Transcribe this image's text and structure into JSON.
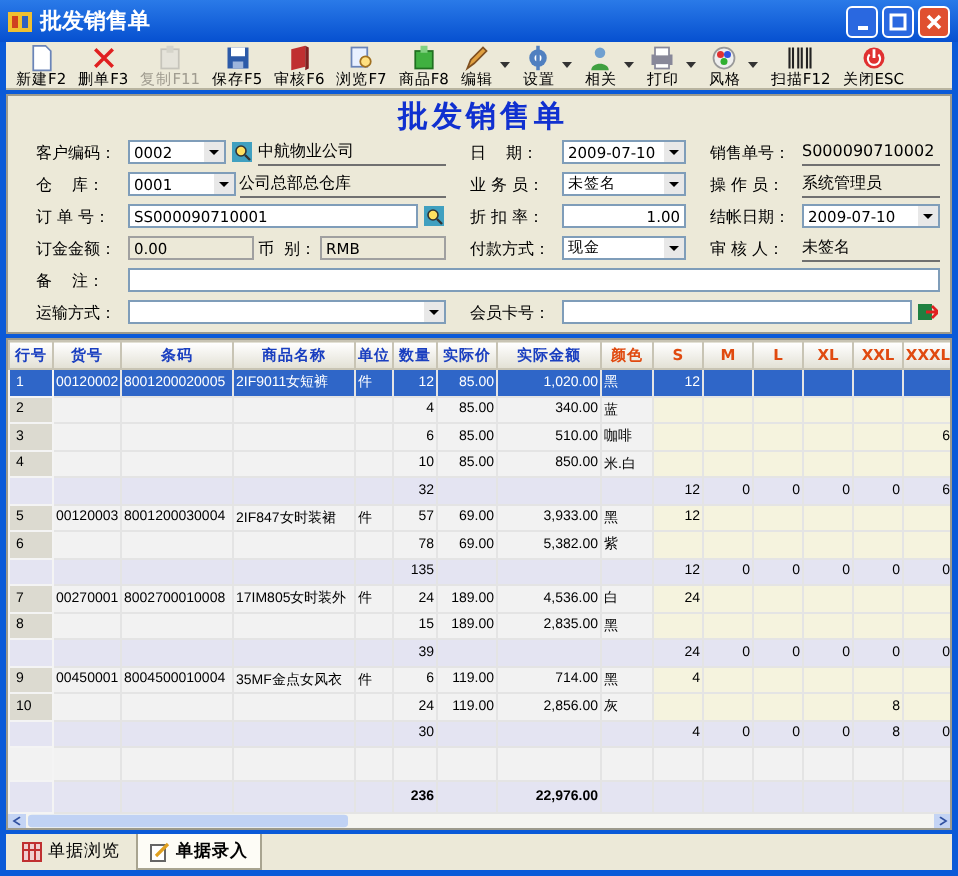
{
  "window": {
    "title": "批发销售单"
  },
  "toolbar": [
    {
      "label": "新建F2",
      "disabled": false,
      "dropdown": false
    },
    {
      "label": "删单F3",
      "disabled": false,
      "dropdown": false
    },
    {
      "label": "复制F11",
      "disabled": true,
      "dropdown": false
    },
    {
      "label": "保存F5",
      "disabled": false,
      "dropdown": false
    },
    {
      "label": "审核F6",
      "disabled": false,
      "dropdown": false
    },
    {
      "label": "浏览F7",
      "disabled": false,
      "dropdown": false
    },
    {
      "label": "商品F8",
      "disabled": false,
      "dropdown": false
    },
    {
      "label": "编辑",
      "disabled": false,
      "dropdown": true
    },
    {
      "label": "设置",
      "disabled": false,
      "dropdown": true
    },
    {
      "label": "相关",
      "disabled": false,
      "dropdown": true
    },
    {
      "label": "打印",
      "disabled": false,
      "dropdown": true
    },
    {
      "label": "风格",
      "disabled": false,
      "dropdown": true
    },
    {
      "label": "扫描F12",
      "disabled": false,
      "dropdown": false
    },
    {
      "label": "关闭ESC",
      "disabled": false,
      "dropdown": false
    }
  ],
  "form": {
    "title": "批发销售单",
    "rows": [
      {
        "cells": [
          [
            {
              "kind": "label",
              "text": "客户编码："
            },
            {
              "kind": "combo",
              "value": "0002"
            },
            {
              "kind": "lookup"
            },
            {
              "kind": "display",
              "text": "中航物业公司"
            }
          ],
          [
            {
              "kind": "label",
              "text": "日    期："
            },
            {
              "kind": "combo",
              "value": "2009-07-10"
            }
          ],
          [
            {
              "kind": "label",
              "text": "销售单号："
            },
            {
              "kind": "display",
              "text": "S000090710002"
            }
          ]
        ]
      },
      {
        "cells": [
          [
            {
              "kind": "label",
              "text": "仓    库："
            },
            {
              "kind": "combo",
              "value": "0001"
            },
            {
              "kind": "display",
              "text": "公司总部总仓库"
            }
          ],
          [
            {
              "kind": "label",
              "text": "业 务 员："
            },
            {
              "kind": "combo",
              "value": "未签名"
            }
          ],
          [
            {
              "kind": "label",
              "text": "操 作 员："
            },
            {
              "kind": "display",
              "text": "系统管理员"
            }
          ]
        ]
      },
      {
        "cells": [
          [
            {
              "kind": "label",
              "text": "订 单 号："
            },
            {
              "kind": "text",
              "value": "SS000090710001"
            },
            {
              "kind": "lookup"
            }
          ],
          [
            {
              "kind": "label",
              "text": "折 扣 率："
            },
            {
              "kind": "number",
              "value": "1.00"
            }
          ],
          [
            {
              "kind": "label",
              "text": "结帐日期："
            },
            {
              "kind": "combo",
              "value": "2009-07-10"
            }
          ]
        ]
      },
      {
        "cells": [
          [
            {
              "kind": "label",
              "text": "订金金额："
            },
            {
              "kind": "readonly",
              "value": "0.00"
            },
            {
              "kind": "label",
              "text": "币  别："
            },
            {
              "kind": "readonly",
              "value": "RMB"
            }
          ],
          [
            {
              "kind": "label",
              "text": "付款方式："
            },
            {
              "kind": "combo",
              "value": "现金"
            }
          ],
          [
            {
              "kind": "label",
              "text": "审 核 人："
            },
            {
              "kind": "display",
              "text": "未签名"
            }
          ]
        ]
      },
      {
        "cells": [
          [
            {
              "kind": "label",
              "text": "备    注："
            },
            {
              "kind": "text"
            }
          ]
        ]
      },
      {
        "cells": [
          [
            {
              "kind": "label",
              "text": "运输方式："
            },
            {
              "kind": "combo"
            }
          ],
          [
            {
              "kind": "label",
              "text": "会员卡号："
            },
            {
              "kind": "text"
            },
            {
              "kind": "card"
            }
          ]
        ]
      }
    ]
  },
  "grid": {
    "columns": [
      {
        "label": "行号",
        "color": "#1a3fc0"
      },
      {
        "label": "货号",
        "color": "#1a3fc0"
      },
      {
        "label": "条码",
        "color": "#1a3fc0"
      },
      {
        "label": "商品名称",
        "color": "#1a3fc0"
      },
      {
        "label": "单位",
        "color": "#1a3fc0"
      },
      {
        "label": "数量",
        "color": "#1a3fc0"
      },
      {
        "label": "实际价",
        "color": "#1a3fc0"
      },
      {
        "label": "实际金额",
        "color": "#1a3fc0"
      },
      {
        "label": "颜色",
        "color": "#e04a10"
      },
      {
        "label": "S",
        "color": "#e04a10"
      },
      {
        "label": "M",
        "color": "#e04a10"
      },
      {
        "label": "L",
        "color": "#e04a10"
      },
      {
        "label": "XL",
        "color": "#e04a10"
      },
      {
        "label": "XXL",
        "color": "#e04a10"
      },
      {
        "label": "XXXL",
        "color": "#e04a10"
      }
    ],
    "rows": [
      {
        "kind": "item",
        "selected": true,
        "no": "1",
        "code": "00120002",
        "barcode": "8001200020005",
        "name": "2IF9011女短裤",
        "unit": "件",
        "qty": "12",
        "price": "85.00",
        "amount": "1,020.00",
        "shade": "黑",
        "s": "12"
      },
      {
        "kind": "item",
        "selected": false,
        "no": "2",
        "qty": "4",
        "price": "85.00",
        "amount": "340.00",
        "shade": "蓝"
      },
      {
        "kind": "item",
        "selected": false,
        "no": "3",
        "qty": "6",
        "price": "85.00",
        "amount": "510.00",
        "shade": "咖啡",
        "xxxl": "6"
      },
      {
        "kind": "item",
        "selected": false,
        "no": "4",
        "qty": "10",
        "price": "85.00",
        "amount": "850.00",
        "shade": "米.白"
      },
      {
        "kind": "subtotal",
        "qty": "32",
        "s": "12",
        "m": "0",
        "l": "0",
        "xl": "0",
        "xxl": "0",
        "xxxl": "6"
      },
      {
        "kind": "item",
        "selected": false,
        "no": "5",
        "code": "00120003",
        "barcode": "8001200030004",
        "name": "2IF847女时装裙",
        "unit": "件",
        "qty": "57",
        "price": "69.00",
        "amount": "3,933.00",
        "shade": "黑",
        "s": "12"
      },
      {
        "kind": "item",
        "selected": false,
        "no": "6",
        "qty": "78",
        "price": "69.00",
        "amount": "5,382.00",
        "shade": "紫"
      },
      {
        "kind": "subtotal",
        "qty": "135",
        "s": "12",
        "m": "0",
        "l": "0",
        "xl": "0",
        "xxl": "0",
        "xxxl": "0"
      },
      {
        "kind": "item",
        "selected": false,
        "no": "7",
        "code": "00270001",
        "barcode": "8002700010008",
        "name": "17IM805女时装外",
        "unit": "件",
        "qty": "24",
        "price": "189.00",
        "amount": "4,536.00",
        "shade": "白",
        "s": "24"
      },
      {
        "kind": "item",
        "selected": false,
        "no": "8",
        "qty": "15",
        "price": "189.00",
        "amount": "2,835.00",
        "shade": "黑"
      },
      {
        "kind": "subtotal",
        "qty": "39",
        "s": "24",
        "m": "0",
        "l": "0",
        "xl": "0",
        "xxl": "0",
        "xxxl": "0"
      },
      {
        "kind": "item",
        "selected": false,
        "no": "9",
        "code": "00450001",
        "barcode": "8004500010004",
        "name": "35MF金点女风衣",
        "unit": "件",
        "qty": "6",
        "price": "119.00",
        "amount": "714.00",
        "shade": "黑",
        "s": "4"
      },
      {
        "kind": "item",
        "selected": false,
        "no": "10",
        "qty": "24",
        "price": "119.00",
        "amount": "2,856.00",
        "shade": "灰",
        "xxl": "8"
      },
      {
        "kind": "subtotal",
        "qty": "30",
        "s": "4",
        "m": "0",
        "l": "0",
        "xl": "0",
        "xxl": "8",
        "xxxl": "0"
      },
      {
        "kind": "blank"
      },
      {
        "kind": "total",
        "qty": "236",
        "amount": "22,976.00"
      }
    ]
  },
  "tabs": [
    {
      "label": "单据浏览",
      "selected": false
    },
    {
      "label": "单据录入",
      "selected": true
    }
  ]
}
